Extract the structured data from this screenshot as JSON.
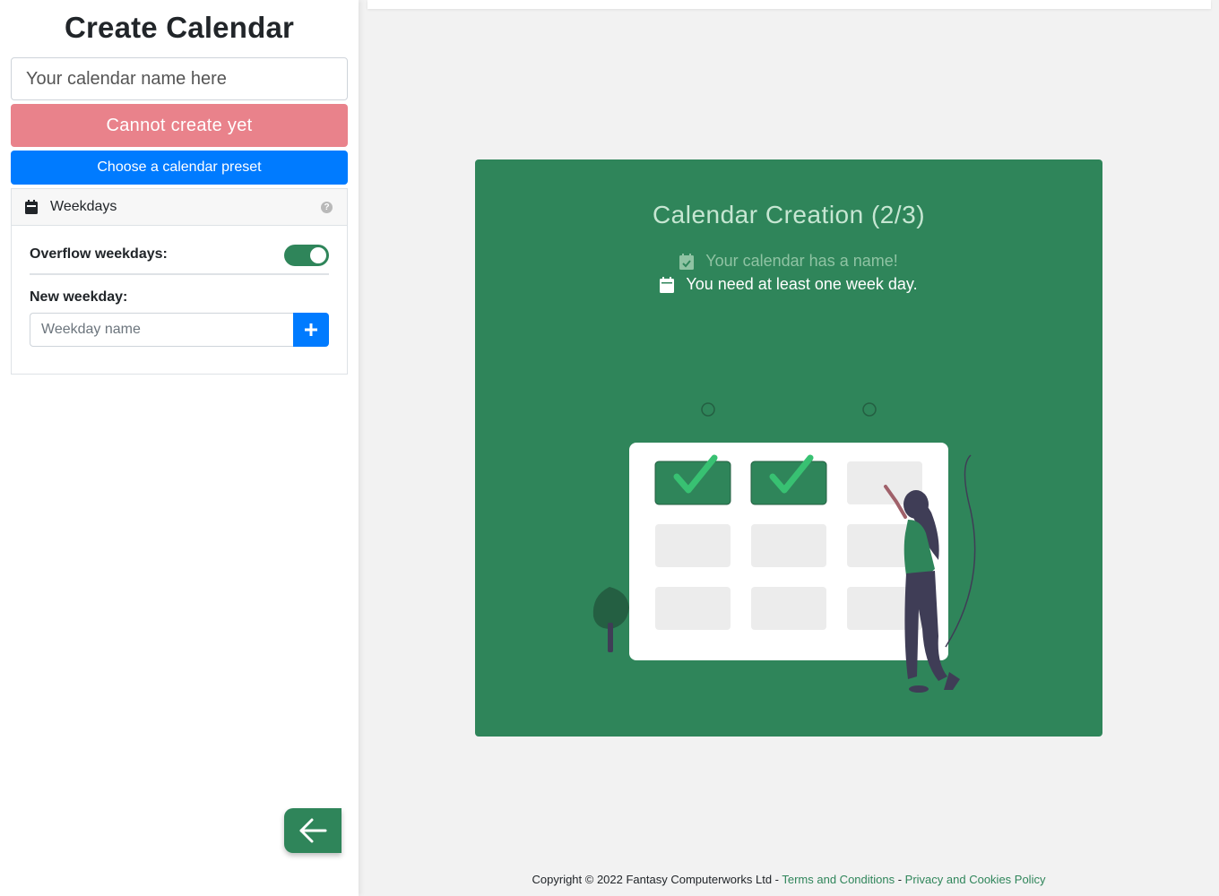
{
  "sidebar": {
    "title": "Create Calendar",
    "name_input_placeholder": "Your calendar name here",
    "create_button_label": "Cannot create yet",
    "preset_button_label": "Choose a calendar preset",
    "weekdays_panel": {
      "title": "Weekdays",
      "help_icon": "?",
      "overflow_label": "Overflow weekdays:",
      "overflow_enabled": true,
      "new_weekday_label": "New weekday:",
      "weekday_input_placeholder": "Weekday name"
    },
    "back_button_icon": "arrow-left-icon"
  },
  "main": {
    "card_title": "Calendar Creation (2/3)",
    "requirements": [
      {
        "text": "Your calendar has a name!",
        "done": true,
        "icon": "calendar-check-icon"
      },
      {
        "text": "You need at least one week day.",
        "done": false,
        "icon": "calendar-icon"
      }
    ]
  },
  "footer": {
    "copyright": "Copyright © 2022 Fantasy Computerworks Ltd - ",
    "terms_label": "Terms and Conditions",
    "separator": " - ",
    "privacy_label": "Privacy and Cookies Policy"
  },
  "colors": {
    "brand_green": "#2f855a",
    "primary_blue": "#007bff",
    "danger_light": "#e9828b"
  }
}
